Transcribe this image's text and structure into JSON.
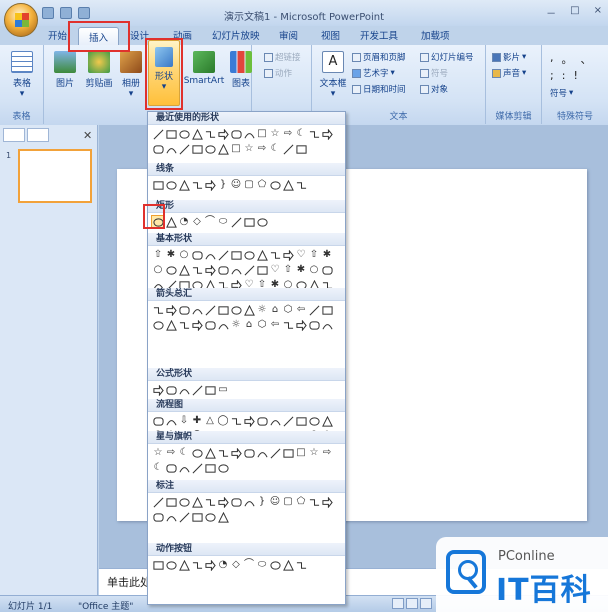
{
  "window": {
    "title": "演示文稿1 - Microsoft PowerPoint",
    "min": "－",
    "max": "□",
    "close": "×"
  },
  "tabs": [
    "开始",
    "插入",
    "设计",
    "动画",
    "幻灯片放映",
    "审阅",
    "视图",
    "开发工具",
    "加载项"
  ],
  "ribbon": {
    "table_label": "表格",
    "table_group": "表格",
    "picture": "图片",
    "clipart": "剪贴画",
    "album": "相册",
    "shapes": "形状",
    "smartart": "SmartArt",
    "chart": "图表",
    "hyperlink": "超链接",
    "action": "动作",
    "textbox": "文本框",
    "header_footer": "页眉和页脚",
    "wordart": "艺术字",
    "datetime": "日期和时间",
    "slide_number": "幻灯片编号",
    "symbol": "符号",
    "object": "对象",
    "text_group": "文本",
    "movie": "影片",
    "sound": "声音",
    "media_group": "媒体剪辑",
    "symbol_btn": "符号",
    "special_group": "特殊符号",
    "special_symbols": [
      ",",
      "。",
      "、",
      ";",
      ":",
      "!"
    ]
  },
  "gallery": {
    "sections": [
      {
        "title": "最近使用的形状",
        "count": 26
      },
      {
        "title": "线条",
        "count": 12
      },
      {
        "title": "矩形",
        "count": 9
      },
      {
        "title": "基本形状",
        "count": 42
      },
      {
        "title": "箭头总汇",
        "count": 28
      },
      {
        "title": "公式形状",
        "count": 6
      },
      {
        "title": "流程图",
        "count": 28
      },
      {
        "title": "星与旗帜",
        "count": 20
      },
      {
        "title": "标注",
        "count": 20
      },
      {
        "title": "动作按钮",
        "count": 12
      }
    ]
  },
  "notes_text": "单击此处",
  "status": {
    "slide": "幻灯片 1/1",
    "theme": "\"Office 主题\""
  },
  "watermark": {
    "top": "PConline",
    "bottom": "IT百科"
  }
}
